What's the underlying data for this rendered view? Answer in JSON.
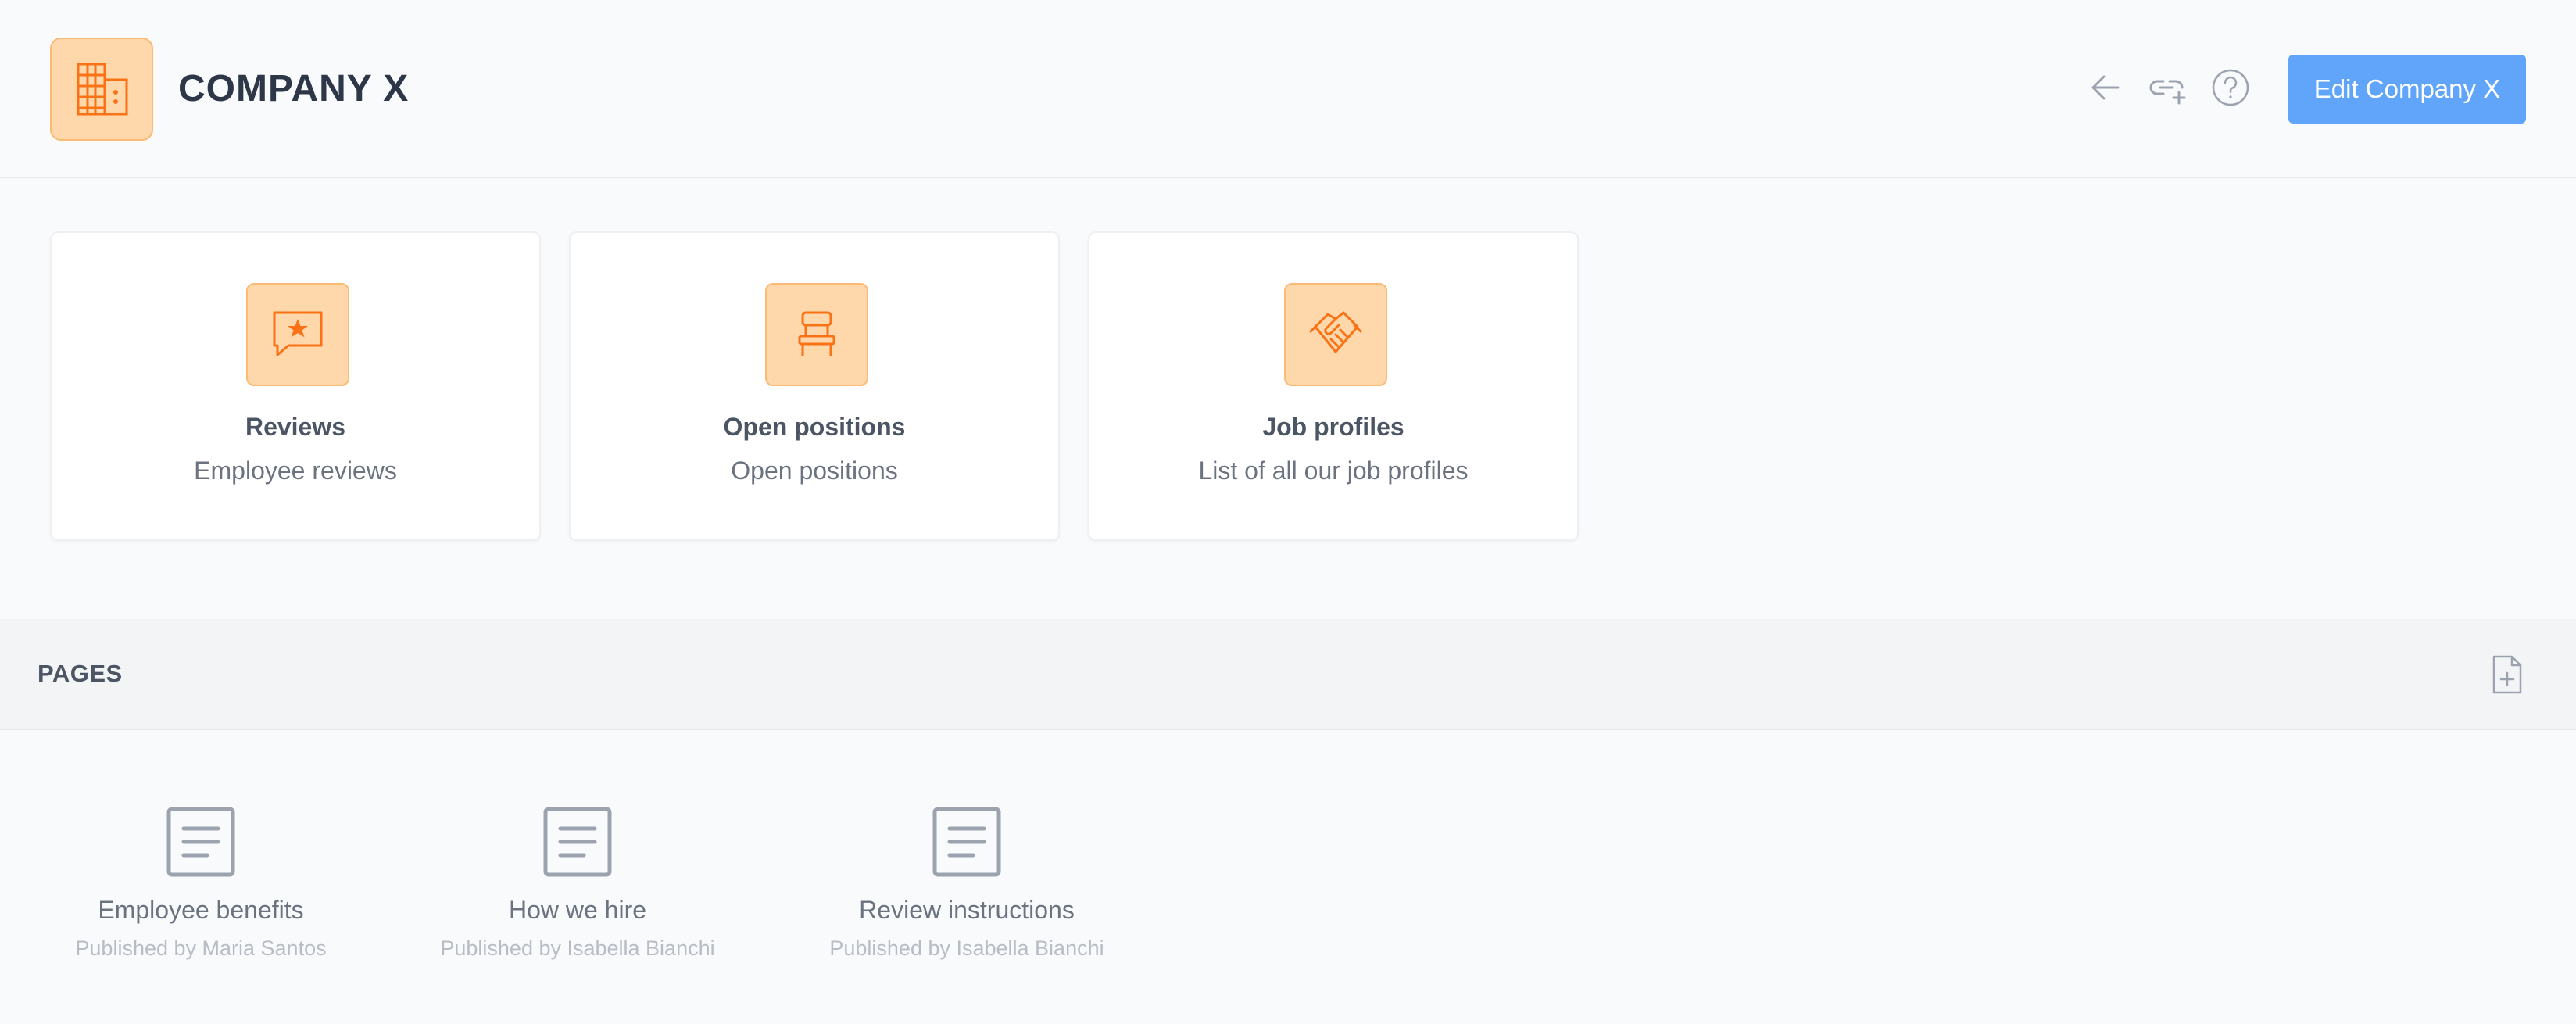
{
  "header": {
    "title": "COMPANY X",
    "logo_icon": "building-icon",
    "edit_label": "Edit Company X",
    "actions": [
      "back-arrow-icon",
      "link-add-icon",
      "help-icon"
    ]
  },
  "cards": [
    {
      "title": "Reviews",
      "subtitle": "Employee reviews",
      "icon": "chat-star-icon"
    },
    {
      "title": "Open positions",
      "subtitle": "Open positions",
      "icon": "chair-icon"
    },
    {
      "title": "Job profiles",
      "subtitle": "List of all our job profiles",
      "icon": "handshake-icon"
    }
  ],
  "pages": {
    "title": "PAGES",
    "add_icon": "add-page-icon",
    "items": [
      {
        "name": "Employee benefits",
        "meta": "Published by Maria Santos"
      },
      {
        "name": "How we hire",
        "meta": "Published by Isabella Bianchi"
      },
      {
        "name": "Review instructions",
        "meta": "Published by Isabella Bianchi"
      }
    ]
  },
  "colors": {
    "accent_orange": "#f97316",
    "icon_bg": "#fed7aa",
    "primary_button": "#60a5fa",
    "background": "#f8fafc"
  }
}
